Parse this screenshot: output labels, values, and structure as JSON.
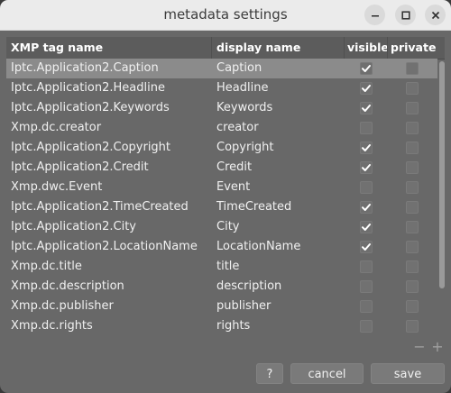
{
  "window": {
    "title": "metadata settings"
  },
  "controls": {
    "minimize_icon": "minimize-icon",
    "maximize_icon": "maximize-icon",
    "close_icon": "close-icon"
  },
  "table": {
    "columns": [
      "XMP tag name",
      "display name",
      "visible",
      "private"
    ],
    "rows": [
      {
        "tag": "Iptc.Application2.Caption",
        "display": "Caption",
        "visible": true,
        "private": false,
        "selected": true
      },
      {
        "tag": "Iptc.Application2.Headline",
        "display": "Headline",
        "visible": true,
        "private": false
      },
      {
        "tag": "Iptc.Application2.Keywords",
        "display": "Keywords",
        "visible": true,
        "private": false
      },
      {
        "tag": "Xmp.dc.creator",
        "display": "creator",
        "visible": false,
        "private": false
      },
      {
        "tag": "Iptc.Application2.Copyright",
        "display": "Copyright",
        "visible": true,
        "private": false
      },
      {
        "tag": "Iptc.Application2.Credit",
        "display": "Credit",
        "visible": true,
        "private": false
      },
      {
        "tag": "Xmp.dwc.Event",
        "display": "Event",
        "visible": false,
        "private": false
      },
      {
        "tag": "Iptc.Application2.TimeCreated",
        "display": "TimeCreated",
        "visible": true,
        "private": false
      },
      {
        "tag": "Iptc.Application2.City",
        "display": "City",
        "visible": true,
        "private": false
      },
      {
        "tag": "Iptc.Application2.LocationName",
        "display": "LocationName",
        "visible": true,
        "private": false
      },
      {
        "tag": "Xmp.dc.title",
        "display": "title",
        "visible": false,
        "private": false
      },
      {
        "tag": "Xmp.dc.description",
        "display": "description",
        "visible": false,
        "private": false
      },
      {
        "tag": "Xmp.dc.publisher",
        "display": "publisher",
        "visible": false,
        "private": false
      },
      {
        "tag": "Xmp.dc.rights",
        "display": "rights",
        "visible": false,
        "private": false
      }
    ]
  },
  "list_controls": {
    "remove_label": "−",
    "add_label": "+"
  },
  "buttons": {
    "help": "?",
    "cancel": "cancel",
    "save": "save"
  }
}
